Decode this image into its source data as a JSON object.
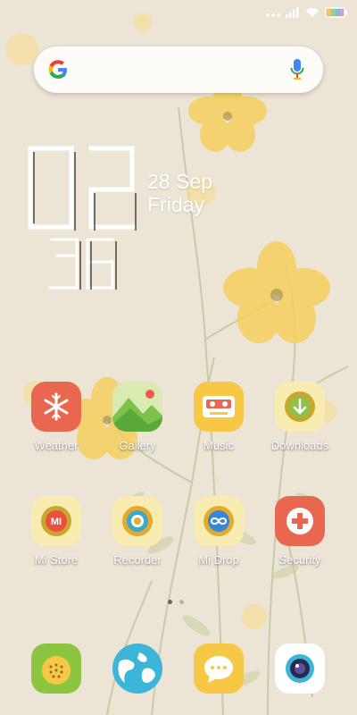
{
  "status_bar": {
    "icons": [
      "dots-icon",
      "signal-icon",
      "wifi-icon",
      "battery-icon"
    ]
  },
  "search": {
    "icons": [
      "google-logo-icon",
      "mic-icon"
    ]
  },
  "clock": {
    "hours": "02",
    "minutes": "36",
    "date": "28 Sep",
    "day": "Friday"
  },
  "apps_row1": [
    {
      "label": "Weather",
      "icon": "weather-icon"
    },
    {
      "label": "Gallery",
      "icon": "gallery-icon"
    },
    {
      "label": "Music",
      "icon": "music-icon"
    },
    {
      "label": "Downloads",
      "icon": "downloads-icon"
    }
  ],
  "apps_row2": [
    {
      "label": "Mi Store",
      "icon": "mi-store-icon"
    },
    {
      "label": "Recorder",
      "icon": "recorder-icon"
    },
    {
      "label": "Mi Drop",
      "icon": "mi-drop-icon"
    },
    {
      "label": "Security",
      "icon": "security-icon"
    }
  ],
  "dock": [
    {
      "icon": "dock-app-1-icon"
    },
    {
      "icon": "browser-icon"
    },
    {
      "icon": "messaging-icon"
    },
    {
      "icon": "camera-icon"
    }
  ],
  "mi_store_logo_text": "MI",
  "pages": {
    "current": 1,
    "total": 2
  }
}
